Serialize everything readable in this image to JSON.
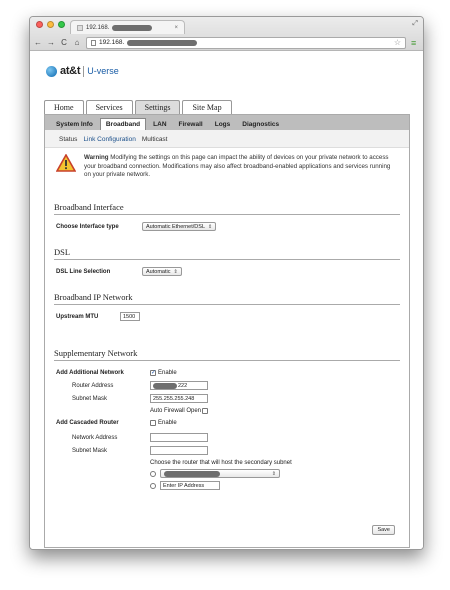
{
  "browser": {
    "tab_title": "192.168.",
    "url": "192.168.",
    "nav_back": "←",
    "nav_forward": "→",
    "nav_reload": "C",
    "nav_home": "⌂",
    "star": "☆",
    "menu": "≡",
    "tab_close": "×",
    "resize": "⤢"
  },
  "logo": {
    "att": "at&t",
    "uverse": "U-verse"
  },
  "main_tabs": [
    {
      "label": "Home"
    },
    {
      "label": "Services"
    },
    {
      "label": "Settings",
      "active": true
    },
    {
      "label": "Site Map"
    }
  ],
  "sub_tabs": [
    {
      "label": "System Info"
    },
    {
      "label": "Broadband",
      "active": true
    },
    {
      "label": "LAN"
    },
    {
      "label": "Firewall"
    },
    {
      "label": "Logs"
    },
    {
      "label": "Diagnostics"
    }
  ],
  "subsub_tabs": [
    {
      "label": "Status"
    },
    {
      "label": "Link Configuration",
      "active": true
    },
    {
      "label": "Multicast"
    }
  ],
  "warning": {
    "heading": "Warning",
    "text": "Modifying the settings on this page can impact the ability of devices on your private network to access your broadband connection. Modifications may also affect broadband-enabled applications and services running on your private network."
  },
  "broadband_interface": {
    "title": "Broadband Interface",
    "label": "Choose Interface type",
    "value": "Automatic Ethernet/DSL"
  },
  "dsl": {
    "title": "DSL",
    "label": "DSL Line Selection",
    "value": "Automatic"
  },
  "ip_network": {
    "title": "Broadband IP Network",
    "label": "Upstream MTU",
    "value": "1500"
  },
  "supplementary": {
    "title": "Supplementary Network",
    "add_network_label": "Add Additional Network",
    "enable_label": "Enable",
    "router_address_label": "Router Address",
    "router_address_value": "222",
    "subnet_mask_label": "Subnet Mask",
    "subnet_mask_value": "255.255.255.248",
    "auto_firewall_label": "Auto Firewall Open",
    "add_cascaded_label": "Add Cascaded Router",
    "cascaded_enable_label": "Enable",
    "network_address_label": "Network Address",
    "cascaded_subnet_label": "Subnet Mask",
    "choose_router_text": "Choose the router that will host the secondary subnet",
    "enter_ip_placeholder": "Enter IP Address",
    "save_label": "Save"
  }
}
